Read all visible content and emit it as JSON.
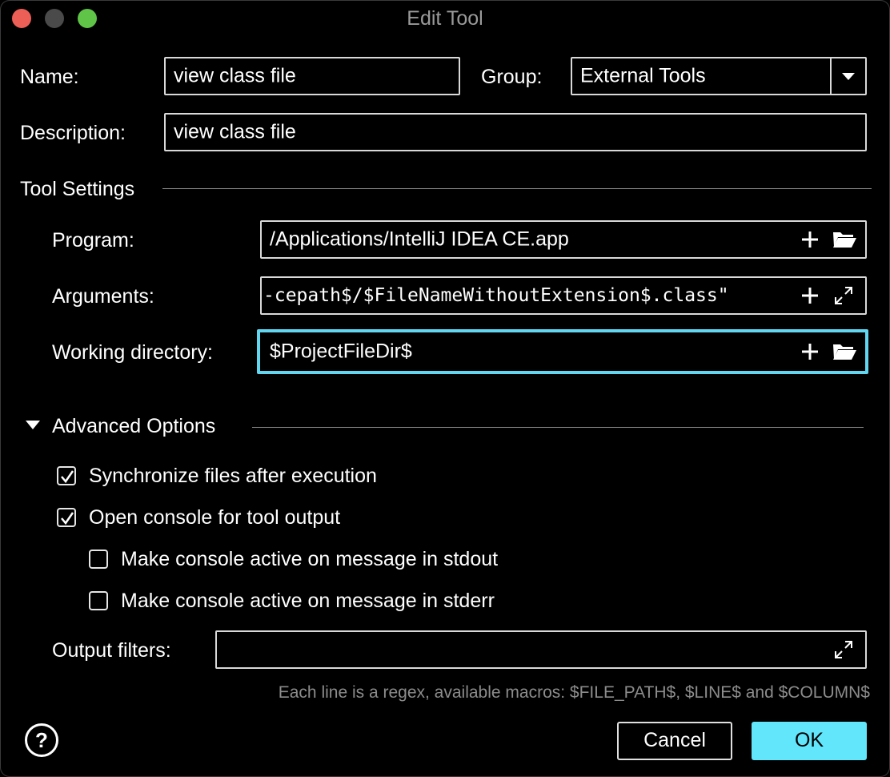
{
  "window": {
    "title": "Edit Tool"
  },
  "form": {
    "name_label": "Name:",
    "name_value": "view class file",
    "group_label": "Group:",
    "group_value": "External Tools",
    "description_label": "Description:",
    "description_value": "view class file"
  },
  "tool_settings": {
    "section_title": "Tool Settings",
    "program_label": "Program:",
    "program_value": "/Applications/IntelliJ IDEA CE.app",
    "arguments_label": "Arguments:",
    "arguments_value": "-cepath$/$FileNameWithoutExtension$.class\"",
    "workdir_label": "Working directory:",
    "workdir_value": "$ProjectFileDir$"
  },
  "advanced": {
    "section_title": "Advanced Options",
    "expanded": true,
    "sync_label": "Synchronize files after execution",
    "sync_checked": true,
    "console_label": "Open console for tool output",
    "console_checked": true,
    "stdout_label": "Make console active on message in stdout",
    "stdout_checked": false,
    "stderr_label": "Make console active on message in stderr",
    "stderr_checked": false,
    "output_filters_label": "Output filters:",
    "output_filters_value": "",
    "hint": "Each line is a regex, available macros: $FILE_PATH$, $LINE$ and $COLUMN$"
  },
  "footer": {
    "help_label": "?",
    "cancel_label": "Cancel",
    "ok_label": "OK"
  },
  "icons": [
    "close-traffic-light",
    "minimize-traffic-light",
    "maximize-traffic-light",
    "chevron-down-icon",
    "plus-icon",
    "folder-icon",
    "expand-icon",
    "triangle-down-icon",
    "checkmark-icon",
    "help-icon"
  ],
  "colors": {
    "focus": "#61d6f1",
    "ok_button": "#61e6fb",
    "close": "#ec5f56",
    "maximize": "#5fc447"
  }
}
